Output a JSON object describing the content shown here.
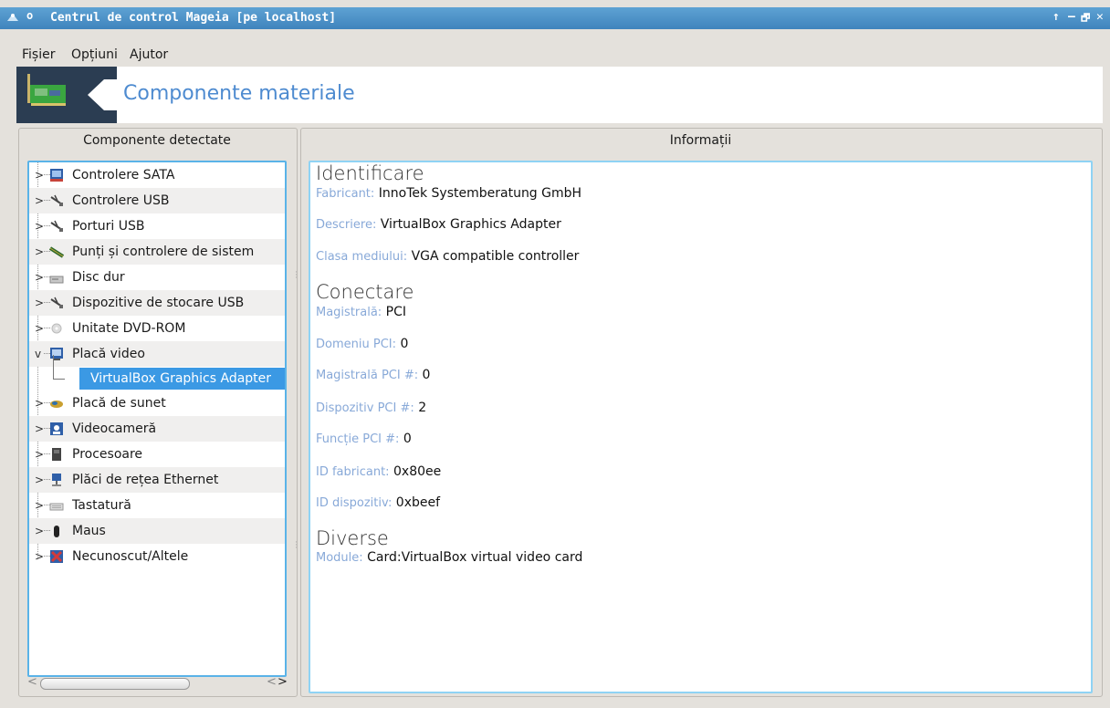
{
  "window": {
    "title": "Centrul de control Mageia  [pe localhost]",
    "title_dot": "o",
    "buttons": [
      "↑",
      "–",
      "🗗",
      "✕"
    ]
  },
  "menu": [
    {
      "label": "Fișier"
    },
    {
      "label": "Opțiuni"
    },
    {
      "label": "Ajutor"
    }
  ],
  "banner": {
    "title": "Componente materiale"
  },
  "panels": {
    "left_header": "Componente detectate",
    "right_header": "Informații"
  },
  "tree": {
    "items": [
      {
        "label": "Controlere SATA",
        "icon": "sata-controller-icon",
        "expander": ">"
      },
      {
        "label": "Controlere USB",
        "icon": "usb-icon",
        "expander": ">"
      },
      {
        "label": "Porturi USB",
        "icon": "usb-icon",
        "expander": ">"
      },
      {
        "label": "Punți și controlere de sistem",
        "icon": "bridge-icon",
        "expander": ">"
      },
      {
        "label": "Disc dur",
        "icon": "hard-disk-icon",
        "expander": ">"
      },
      {
        "label": "Dispozitive de stocare USB",
        "icon": "usb-icon",
        "expander": ">"
      },
      {
        "label": "Unitate DVD-ROM",
        "icon": "dvd-icon",
        "expander": ">"
      },
      {
        "label": "Placă video",
        "icon": "video-card-icon",
        "expander": "v"
      },
      {
        "label": "Placă de sunet",
        "icon": "sound-card-icon",
        "expander": ">"
      },
      {
        "label": "Videocameră",
        "icon": "webcam-icon",
        "expander": ">"
      },
      {
        "label": "Procesoare",
        "icon": "cpu-icon",
        "expander": ">"
      },
      {
        "label": "Plăci de rețea Ethernet",
        "icon": "network-icon",
        "expander": ">"
      },
      {
        "label": "Tastatură",
        "icon": "keyboard-icon",
        "expander": ">"
      },
      {
        "label": "Maus",
        "icon": "mouse-icon",
        "expander": ">"
      },
      {
        "label": "Necunoscut/Altele",
        "icon": "unknown-device-icon",
        "expander": ">"
      }
    ],
    "selected_child": "VirtualBox Graphics Adapter"
  },
  "info": {
    "sections": [
      {
        "title": "Identificare"
      },
      {
        "title": "Conectare"
      },
      {
        "title": "Diverse"
      }
    ],
    "fields": [
      {
        "key": "Fabricant:",
        "value": "InnoTek Systemberatung GmbH"
      },
      {
        "key": "Descriere:",
        "value": "VirtualBox Graphics Adapter"
      },
      {
        "key": "Clasa mediului:",
        "value": "VGA compatible controller"
      },
      {
        "key": "Magistrală:",
        "value": "PCI"
      },
      {
        "key": "Domeniu PCI:",
        "value": "0"
      },
      {
        "key": "Magistrală PCI #:",
        "value": "0"
      },
      {
        "key": "Dispozitiv PCI #:",
        "value": "2"
      },
      {
        "key": "Funcție PCI #:",
        "value": "0"
      },
      {
        "key": "ID fabricant:",
        "value": "0x80ee"
      },
      {
        "key": "ID dispozitiv:",
        "value": "0xbeef"
      },
      {
        "key": "Module:",
        "value": "Card:VirtualBox virtual video card"
      }
    ]
  },
  "scrollbar": {
    "left_arrow": "<",
    "right_arrow": ">"
  }
}
